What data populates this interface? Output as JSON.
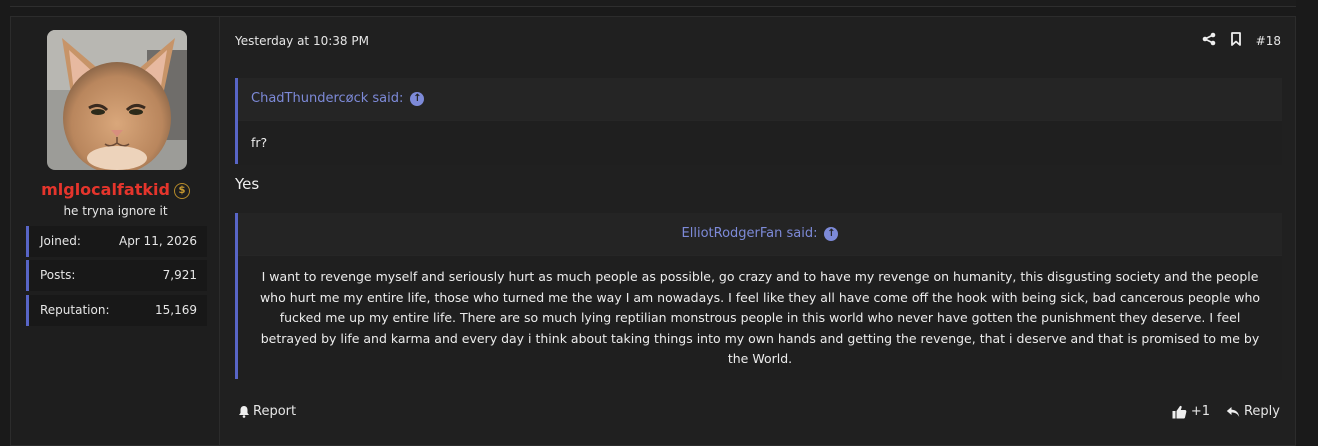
{
  "post": {
    "timestamp": "Yesterday at 10:38 PM",
    "number": "#18",
    "reply_text": "Yes"
  },
  "author": {
    "username": "mlglocalfatkid",
    "title": "he tryna ignore it",
    "stats": [
      {
        "label": "Joined:",
        "value": "Apr 11, 2026"
      },
      {
        "label": "Posts:",
        "value": "7,921"
      },
      {
        "label": "Reputation:",
        "value": "15,169"
      }
    ]
  },
  "quotes": [
    {
      "attribution": "ChadThundercøck said:",
      "body": "fr?"
    },
    {
      "attribution": "ElliotRodgerFan said:",
      "body": "I want to revenge myself and seriously hurt as much people as possible, go crazy and to have my revenge on humanity, this disgusting society and the people who hurt me my entire life, those who turned me the way I am nowadays. I feel like they all have come off the hook with being sick, bad cancerous people who fucked me up my entire life. There are so much lying reptilian monstrous people in this world who never have gotten the punishment they deserve. I feel betrayed by life and karma and every day i think about taking things into my own hands and getting the revenge, that i deserve and that is promised to me by the World."
    }
  ],
  "footer": {
    "report_label": "Report",
    "reaction_count": "+1",
    "reply_label": "Reply"
  },
  "icons": [
    "share-icon",
    "bookmark-icon",
    "go-to-quote-icon",
    "dollar-badge-icon",
    "bell-icon",
    "thumbs-up-icon",
    "reply-arrow-icon"
  ],
  "colors": {
    "accent": "#5865c6",
    "username": "#e5352c",
    "quote_attr": "#7d8ad8"
  }
}
